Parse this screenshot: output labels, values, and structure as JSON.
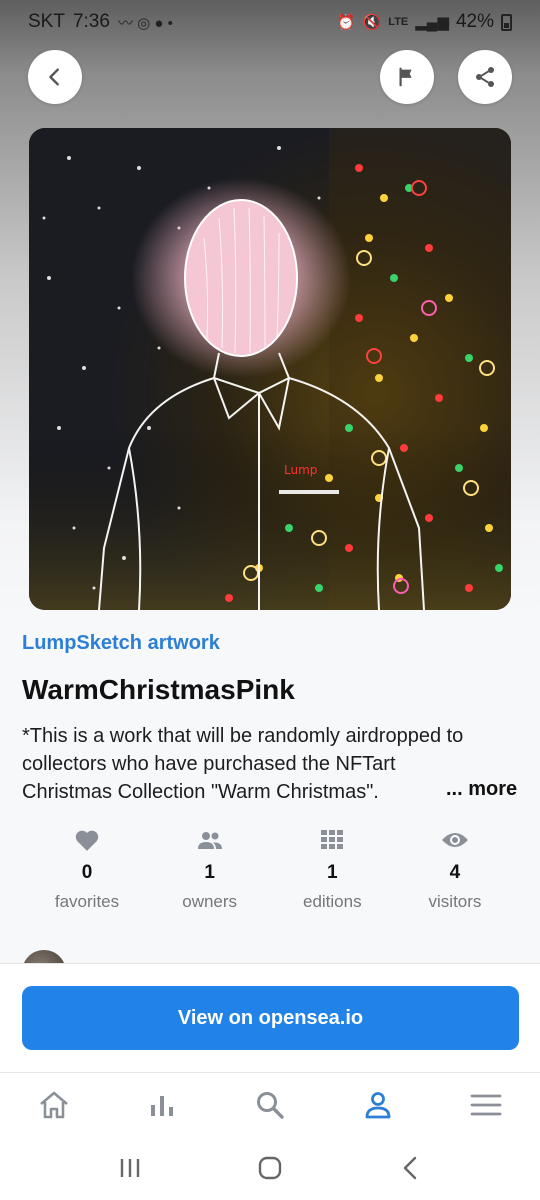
{
  "status_bar": {
    "carrier": "SKT",
    "time": "7:36",
    "network": "LTE",
    "battery": "42%"
  },
  "header": {
    "back_icon": "chevron-left-icon",
    "flag_icon": "flag-icon",
    "share_icon": "share-icon"
  },
  "artwork": {
    "image": "christmas-tree-figure-artwork",
    "signature": "Lump"
  },
  "nft": {
    "artist_link": "LumpSketch artwork",
    "title": "WarmChristmasPink",
    "description_lines": [
      "*This is a work that will be randomly airdropped to",
      "collectors who have purchased the NFTart",
      "Christmas Collection \"Warm Christmas\"."
    ],
    "more_label": "... more"
  },
  "stats": [
    {
      "icon": "heart-icon",
      "value": "0",
      "label": "favorites"
    },
    {
      "icon": "people-icon",
      "value": "1",
      "label": "owners"
    },
    {
      "icon": "grid-icon",
      "value": "1",
      "label": "editions"
    },
    {
      "icon": "eye-icon",
      "value": "4",
      "label": "visitors"
    }
  ],
  "cta": {
    "label": "View on opensea.io"
  },
  "bottom_nav": [
    {
      "icon": "home-icon",
      "active": false
    },
    {
      "icon": "bar-chart-icon",
      "active": false
    },
    {
      "icon": "search-icon",
      "active": false
    },
    {
      "icon": "profile-icon",
      "active": true
    },
    {
      "icon": "menu-icon",
      "active": false
    }
  ],
  "colors": {
    "accent": "#2182e8",
    "link": "#2d7fd6",
    "icon_gray": "#8a8f98",
    "nav_active": "#2d7fd6"
  }
}
